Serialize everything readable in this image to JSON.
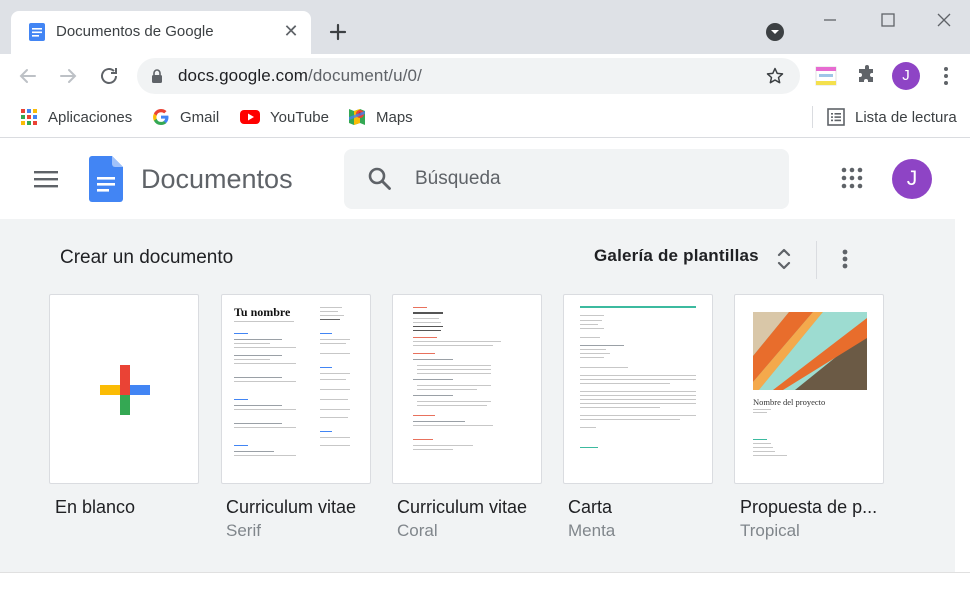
{
  "browser": {
    "tab_title": "Documentos de Google",
    "url_host": "docs.google.com",
    "url_path": "/document/u/0/",
    "avatar_letter": "J"
  },
  "bookmarks": [
    {
      "label": "Aplicaciones",
      "icon": "apps-grid-icon"
    },
    {
      "label": "Gmail",
      "icon": "google-g-icon"
    },
    {
      "label": "YouTube",
      "icon": "youtube-icon"
    },
    {
      "label": "Maps",
      "icon": "maps-icon"
    }
  ],
  "reading_list": "Lista de lectura",
  "docs": {
    "title": "Documentos",
    "search_placeholder": "Búsqueda",
    "avatar_letter": "J"
  },
  "gallery": {
    "heading": "Crear un documento",
    "gallery_label": "Galería de plantillas",
    "templates": [
      {
        "name": "En blanco",
        "sub": ""
      },
      {
        "name": "Curriculum vitae",
        "sub": "Serif"
      },
      {
        "name": "Curriculum vitae",
        "sub": "Coral"
      },
      {
        "name": "Carta",
        "sub": "Menta"
      },
      {
        "name": "Propuesta de p...",
        "sub": "Tropical"
      }
    ],
    "thumb_text": {
      "serif_heading": "Tu nombre",
      "tropical_heading": "Nombre del proyecto"
    }
  },
  "colors": {
    "docs_blue": "#4285f4",
    "avatar_purple": "#8e44c5",
    "coral": "#e8715d",
    "mint": "#3cba9f"
  }
}
